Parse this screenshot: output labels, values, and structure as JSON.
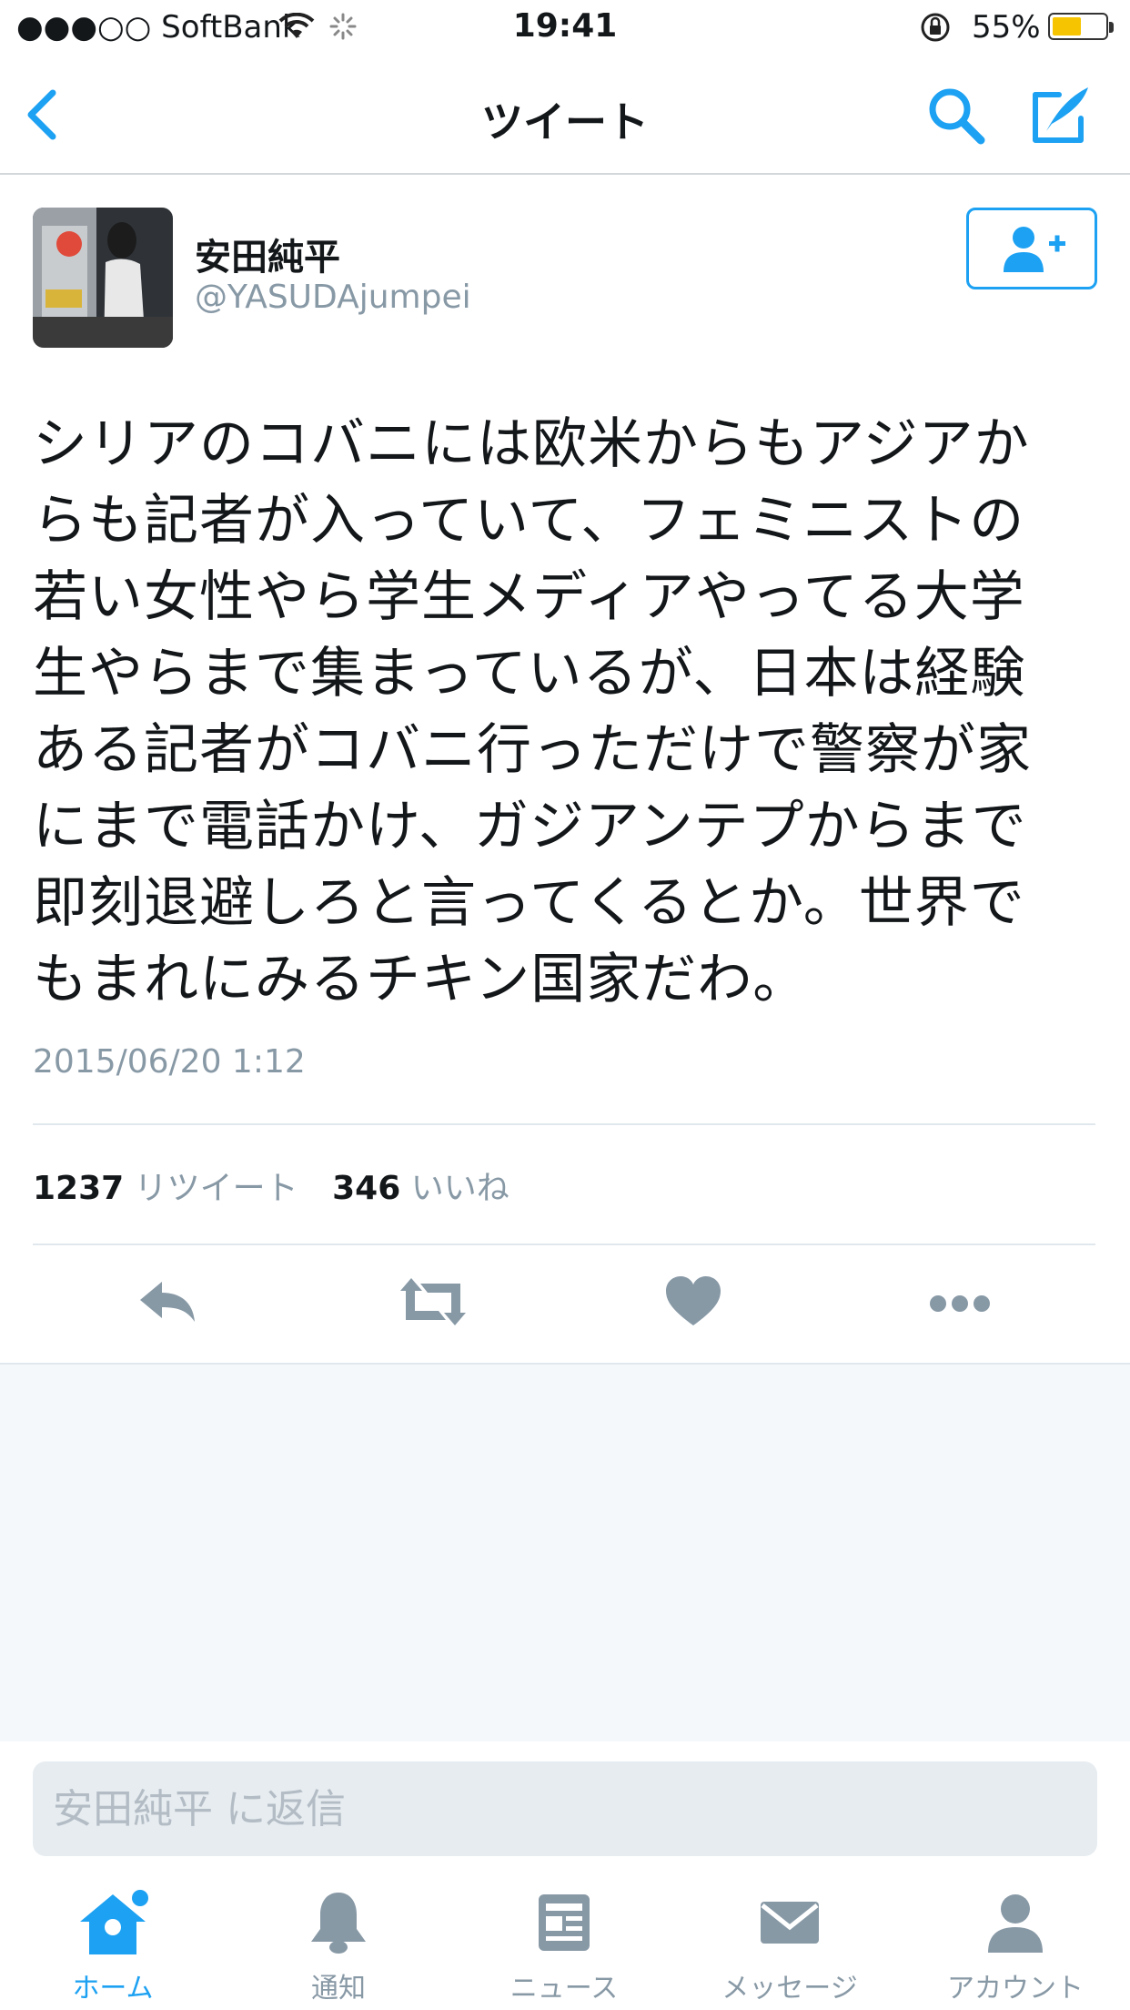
{
  "status_bar": {
    "carrier": "●●●○○ SoftBank",
    "time": "19:41",
    "battery": "55%",
    "battery_level": 0.55
  },
  "nav": {
    "title": "ツイート",
    "back_icon": "chevron-left-icon",
    "search_icon": "search-icon",
    "compose_icon": "compose-icon"
  },
  "tweet": {
    "user_name": "安田純平",
    "user_handle": "@YASUDAjumpei",
    "text": "シリアのコバニには欧米からもアジアか\nらも記者が入っていて、フェミニストの\n若い女性やら学生メディアやってる大学\n生やらまで集まっているが、日本は経験\nある記者がコバニ行っただけで警察が家\nにまで電話かけ、ガジアンテプからまで\n即刻退避しろと言ってくるとか。世界で\nもまれにみるチキン国家だわ。",
    "timestamp": "2015/06/20 1:12",
    "retweets": "1237",
    "retweets_label": "リツイート",
    "likes": "346",
    "likes_label": "いいね"
  },
  "reply": {
    "placeholder": "安田純平 に返信"
  },
  "tabs": [
    {
      "label": "ホーム",
      "icon": "home-icon",
      "active": true
    },
    {
      "label": "通知",
      "icon": "bell-icon",
      "active": false
    },
    {
      "label": "ニュース",
      "icon": "news-icon",
      "active": false
    },
    {
      "label": "メッセージ",
      "icon": "envelope-icon",
      "active": false
    },
    {
      "label": "アカウント",
      "icon": "account-icon",
      "active": false
    }
  ],
  "colors": {
    "accent": "#1da1f2",
    "muted": "#8899a6",
    "icon_gray": "#8899a6",
    "battery": "#f6c400"
  }
}
